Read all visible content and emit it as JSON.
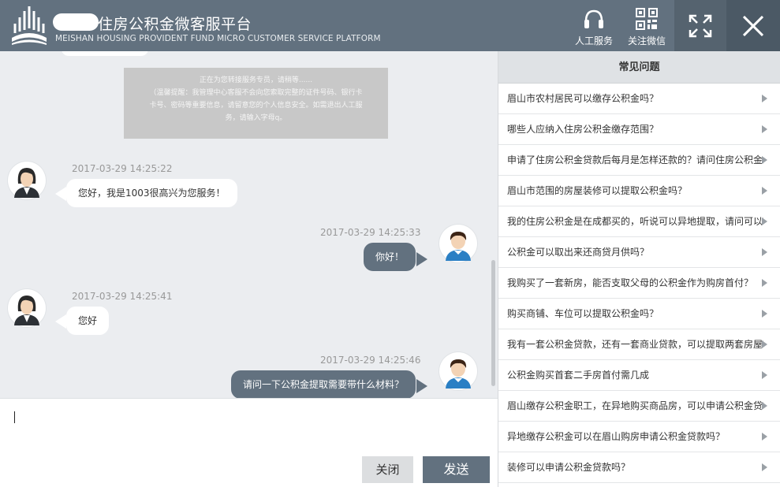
{
  "header": {
    "title": "住房公积金微客服平台",
    "subtitle": "MEISHAN HOUSING PROVIDENT FUND MICRO CUSTOMER SERVICE PLATFORM",
    "buttons": {
      "service": {
        "label": "人工服务",
        "icon": "headset-icon"
      },
      "wechat": {
        "label": "关注微信",
        "icon": "qr-code-icon"
      },
      "expand": {
        "icon": "expand-icon"
      },
      "close": {
        "icon": "close-icon"
      }
    },
    "colors": {
      "bar": "#62717f",
      "text": "#ffffff"
    }
  },
  "chat": {
    "system_notice": {
      "line1": "正在为您转接服务专员，请稍等......",
      "line2": "（温馨提醒：我管理中心客服不会向您索取完整的证件号码、银行卡",
      "line3": "卡号、密码等重要信息，请留意您的个人信息安全。如需退出人工服",
      "line4": "务，请输入字母q。"
    },
    "messages": [
      {
        "side": "agent",
        "time": "2017-03-29 14:25:22",
        "text": "您好，我是1003很高兴为您服务！"
      },
      {
        "side": "user",
        "time": "2017-03-29 14:25:33",
        "text": "你好！"
      },
      {
        "side": "agent",
        "time": "2017-03-29 14:25:41",
        "text": "您好"
      },
      {
        "side": "user",
        "time": "2017-03-29 14:25:46",
        "text": "请问一下公积金提取需要带什么材料？"
      }
    ]
  },
  "input": {
    "value": "",
    "close_label": "关闭",
    "send_label": "发送"
  },
  "faq": {
    "title": "常见问题",
    "items": [
      "眉山市农村居民可以缴存公积金吗？",
      "哪些人应纳入住房公积金缴存范围？",
      "申请了住房公积金贷款后每月是怎样还款的？请问住房公积金工",
      "眉山市范围的房屋装修可以提取公积金吗？",
      "我的住房公积金是在成都买的，听说可以异地提取，请问可以？",
      "公积金可以取出来还商贷月供吗？",
      "我购买了一套新房，能否支取父母的公积金作为购房首付？",
      "购买商铺、车位可以提取公积金吗？",
      "我有一套公积金贷款，还有一套商业贷款，可以提取两套房屋？",
      "公积金购买首套二手房首付需几成",
      "眉山缴存公积金职工，在异地购买商品房，可以申请公积金贷？",
      "异地缴存公积金可以在眉山购房申请公积金贷款吗？",
      "装修可以申请公积金贷款吗？"
    ]
  }
}
